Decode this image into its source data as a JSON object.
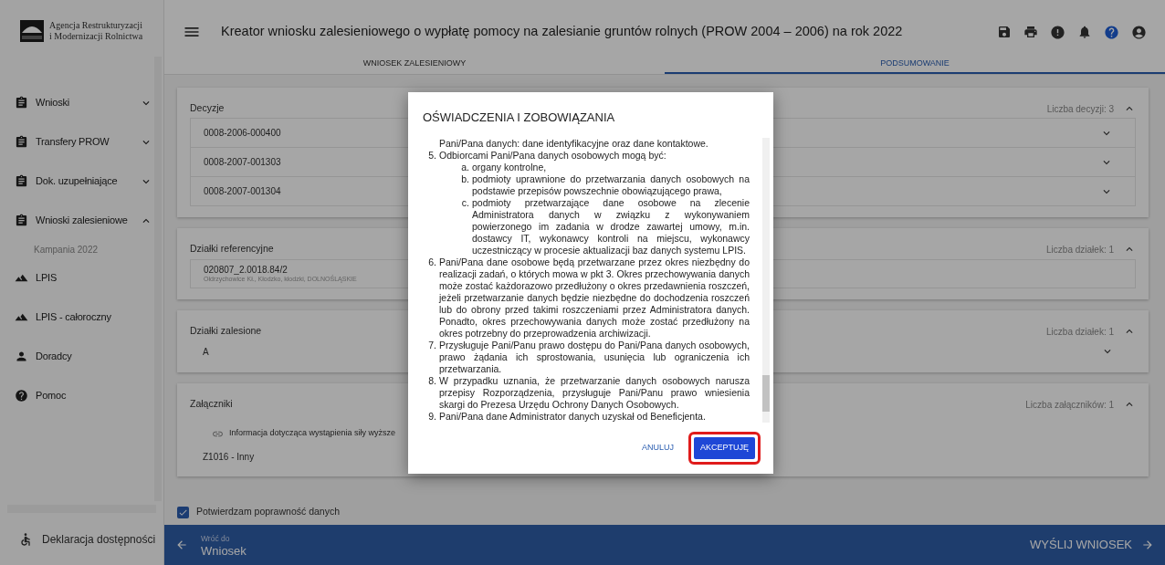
{
  "sidebar": {
    "logo_text": [
      "Agencja Restrukturyzacji",
      "i Modernizacji Rolnictwa"
    ],
    "items": [
      {
        "label": "Wnioski",
        "kind": "group",
        "expanded": false
      },
      {
        "label": "Transfery PROW",
        "kind": "group",
        "expanded": false
      },
      {
        "label": "Dok. uzupełniające",
        "kind": "group",
        "expanded": false
      },
      {
        "label": "Wnioski zalesieniowe",
        "kind": "group",
        "expanded": true,
        "children": [
          {
            "label": "Kampania 2022"
          }
        ]
      },
      {
        "label": "LPIS",
        "kind": "link"
      },
      {
        "label": "LPIS - całoroczny",
        "kind": "link"
      },
      {
        "label": "Doradcy",
        "kind": "link"
      },
      {
        "label": "Pomoc",
        "kind": "link"
      }
    ],
    "footer": "Deklaracja dostępności"
  },
  "header": {
    "title": "Kreator wniosku zalesieniowego o wypłatę pomocy na zalesianie gruntów rolnych (PROW 2004 – 2006) na rok 2022"
  },
  "tabs": [
    {
      "label": "WNIOSEK ZALESIENIOWY",
      "selected": false
    },
    {
      "label": "PODSUMOWANIE",
      "selected": true
    }
  ],
  "sections": [
    {
      "title": "Decyzje",
      "count": "Liczba decyzji: 3",
      "expanded": true,
      "rows": [
        {
          "kind": "expandable",
          "text": "0008-2006-000400"
        },
        {
          "kind": "expandable",
          "text": "0008-2007-001303"
        },
        {
          "kind": "expandable",
          "text": "0008-2007-001304"
        }
      ]
    },
    {
      "title": "Działki referencyjne",
      "count": "Liczba działek: 1",
      "expanded": true,
      "rows": [
        {
          "kind": "parcel",
          "text": "020807_2.0018.84/2",
          "sub": "Ołdrzychowice Kł., Kłodzko, kłodzki, DOLNOŚLĄSKIE"
        }
      ]
    },
    {
      "title": "Działki zalesione",
      "count": "Liczba działek: 1",
      "expanded": true,
      "rows": [
        {
          "kind": "plain-expandable",
          "text": "A"
        }
      ]
    },
    {
      "title": "Załączniki",
      "count": "Liczba załączników: 1",
      "expanded": true,
      "rows": [
        {
          "kind": "attachment",
          "text": "Informacja dotycząca wystąpienia siły wyższe"
        },
        {
          "kind": "plain",
          "text": "Z1016 - Inny"
        }
      ]
    }
  ],
  "confirm": {
    "label": "Potwierdzam poprawność danych",
    "checked": true
  },
  "footer_bar": {
    "back_caption": "Wróć do",
    "back_label": "Wniosek",
    "submit": "WYŚLIJ WNIOSEK"
  },
  "dialog": {
    "title": "OŚWIADCZENIA I ZOBOWIĄZANIA",
    "items": [
      {
        "marker": "",
        "text": "Pani/Pana danych: dane identyfikacyjne oraz dane kontaktowe."
      },
      {
        "marker": "5.",
        "text": "Odbiorcami Pani/Pana danych osobowych mogą być:",
        "children": [
          {
            "marker": "a.",
            "text": "organy kontrolne,"
          },
          {
            "marker": "b.",
            "text": "podmioty uprawnione do przetwarzania danych osobowych na podstawie przepisów powszechnie obowiązującego prawa,"
          },
          {
            "marker": "c.",
            "text": "podmioty przetwarzające dane osobowe na zlecenie Administratora danych w związku z wykonywaniem powierzonego im zadania w drodze zawartej umowy, m.in. dostawcy IT, wykonawcy kontroli na miejscu, wykonawcy uczestniczący w procesie aktualizacji baz danych systemu LPIS."
          }
        ]
      },
      {
        "marker": "6.",
        "text": "Pani/Pana dane osobowe będą przetwarzane przez okres niezbędny do realizacji zadań, o których mowa w pkt 3. Okres przechowywania danych może zostać każdorazowo przedłużony o okres przedawnienia roszczeń, jeżeli przetwarzanie danych będzie niezbędne do dochodzenia roszczeń lub do obrony przed takimi roszczeniami przez Administratora danych. Ponadto, okres przechowywania danych może zostać przedłużony na okres potrzebny do przeprowadzenia archiwizacji."
      },
      {
        "marker": "7.",
        "text": "Przysługuje Pani/Panu prawo dostępu do Pani/Pana danych osobowych, prawo żądania ich sprostowania, usunięcia lub ograniczenia ich przetwarzania."
      },
      {
        "marker": "8.",
        "text": "W przypadku uznania, że przetwarzanie danych osobowych narusza przepisy Rozporządzenia, przysługuje Pani/Panu prawo wniesienia skargi do Prezesa Urzędu Ochrony Danych Osobowych."
      },
      {
        "marker": "9.",
        "text": "Pani/Pana dane Administrator danych uzyskał od Beneficjenta."
      }
    ],
    "buttons": [
      {
        "label": "ANULUJ",
        "kind": "text"
      },
      {
        "label": "AKCEPTUJĘ",
        "kind": "primary",
        "highlighted": true
      }
    ]
  }
}
